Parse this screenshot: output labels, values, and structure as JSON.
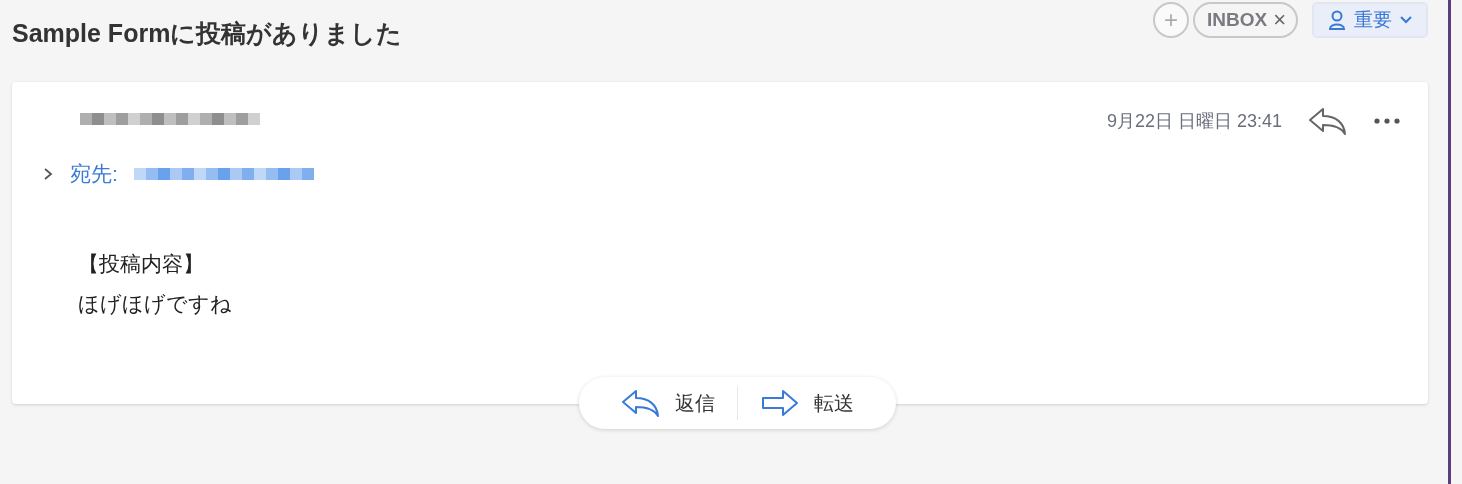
{
  "title": "Sample Formに投稿がありました",
  "labels": {
    "add": "+",
    "tags": [
      {
        "label": "INBOX",
        "remove": "×"
      }
    ],
    "category": {
      "label": "重要"
    }
  },
  "message": {
    "sender": {
      "kind": "redacted"
    },
    "date": "9月22日 日曜日 23:41",
    "recipients": {
      "label": "宛先:",
      "kind": "redacted",
      "expanded": false
    },
    "body": [
      "【投稿内容】",
      "ほげほげですね"
    ]
  },
  "actions": [
    {
      "label": "返信",
      "kind": "reply"
    },
    {
      "label": "転送",
      "kind": "forward"
    }
  ]
}
